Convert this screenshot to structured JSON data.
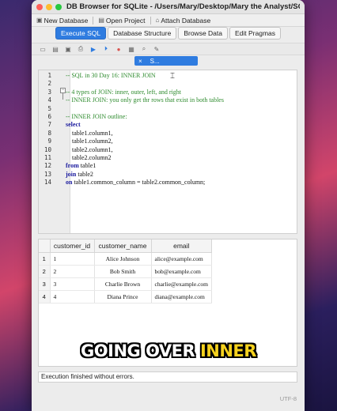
{
  "window": {
    "title": "DB Browser for SQLite - /Users/Mary/Desktop/Mary the Analyst/SQL i..."
  },
  "actions": [
    {
      "label": "New Database",
      "icon": "new-database-icon"
    },
    {
      "label": "Open Project",
      "icon": "open-project-icon"
    },
    {
      "label": "Attach Database",
      "icon": "attach-database-icon"
    }
  ],
  "tabs": [
    "Execute SQL",
    "Database Structure",
    "Browse Data",
    "Edit Pragmas"
  ],
  "active_tab": "Execute SQL",
  "sql_tab": {
    "close": "×",
    "label": "S..."
  },
  "editor": {
    "line_numbers": [
      "1",
      "2",
      "3",
      "4",
      "5",
      "6",
      "7",
      "8",
      "9",
      "10",
      "11",
      "12",
      "13",
      "14"
    ],
    "lines": [
      "-- SQL in 30 Day 16: INNER JOIN",
      "",
      "-- 4 types of JOIN: inner, outer, left, and right",
      "-- INNER JOIN: you only get thr rows that exist in both tables",
      "",
      "-- INNER JOIN outline:",
      "select",
      "    table1.column1,",
      "    table1.column2,",
      "    table2.column1,",
      "    table2.column2",
      "from table1",
      "join table2",
      "on table1.common_column = table2.common_column;"
    ]
  },
  "results": {
    "columns": [
      "customer_id",
      "customer_name",
      "email"
    ],
    "rows": [
      {
        "n": "1",
        "id": "1",
        "name": "Alice Johnson",
        "email": "alice@example.com"
      },
      {
        "n": "2",
        "id": "2",
        "name": "Bob Smith",
        "email": "bob@example.com"
      },
      {
        "n": "3",
        "id": "3",
        "name": "Charlie Brown",
        "email": "charlie@example.com"
      },
      {
        "n": "4",
        "id": "4",
        "name": "Diana Prince",
        "email": "diana@example.com"
      }
    ]
  },
  "status": "Execution finished without errors.",
  "encoding": "UTF-8",
  "caption": {
    "part1": "GOING OVER ",
    "part2": "INNER"
  },
  "colors": {
    "accent": "#2f7ce0",
    "caption_highlight": "#f6d21e"
  }
}
